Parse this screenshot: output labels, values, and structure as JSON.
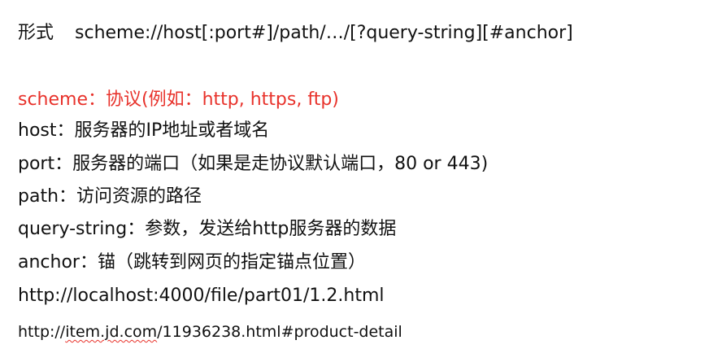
{
  "title": {
    "label": "形式",
    "pattern": "scheme://host[:port#]/path/…/[?query-string][#anchor]"
  },
  "lines": [
    "scheme：协议(例如：http, https, ftp)",
    "host：服务器的IP地址或者域名",
    "port：服务器的端口（如果是走协议默认端口，80   or    443)",
    "path：访问资源的路径",
    "query-string：参数，发送给http服务器的数据",
    "anchor：锚（跳转到网页的指定锚点位置）",
    "http://localhost:4000/file/part01/1.2.html"
  ],
  "last_line": {
    "prefix": "http://",
    "underlined": "item.jd.com",
    "suffix": "/11936238.html#product-detail"
  },
  "colors": {
    "highlight": "#e8322b",
    "text": "#111111",
    "background": "#ffffff"
  }
}
